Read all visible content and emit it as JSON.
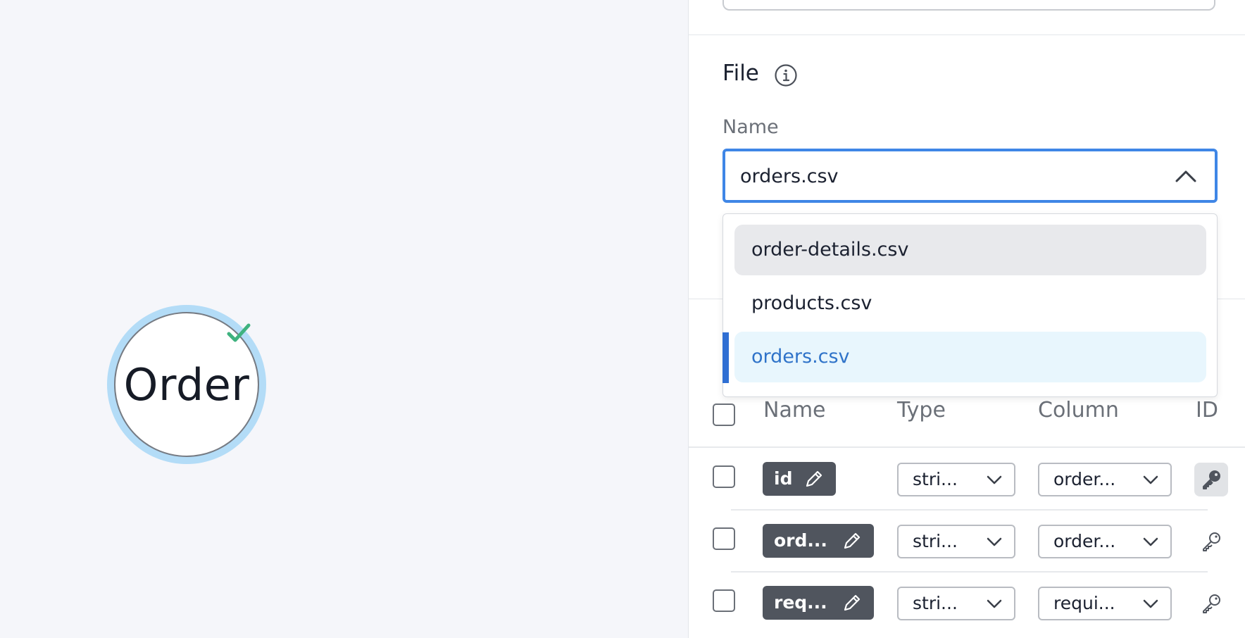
{
  "canvas": {
    "node": {
      "label": "Order",
      "status_icon": "check-icon",
      "status_color": "#3fb27f",
      "ring_color": "#b3dcf7"
    }
  },
  "panel": {
    "file_section": {
      "title": "File",
      "info_icon": "info-icon",
      "name_label": "Name",
      "selected_file": "orders.csv",
      "accent_color": "#3f86e6",
      "options": [
        {
          "label": "order-details.csv",
          "state": "hovered"
        },
        {
          "label": "products.csv",
          "state": "normal"
        },
        {
          "label": "orders.csv",
          "state": "selected"
        }
      ]
    },
    "table": {
      "headers": {
        "name": "Name",
        "type": "Type",
        "column": "Column",
        "id": "ID"
      },
      "rows": [
        {
          "name": "id",
          "type": "stri...",
          "column": "order...",
          "is_id": true
        },
        {
          "name": "ord...",
          "type": "stri...",
          "column": "order...",
          "is_id": false
        },
        {
          "name": "req...",
          "type": "stri...",
          "column": "requi...",
          "is_id": false
        }
      ]
    }
  }
}
